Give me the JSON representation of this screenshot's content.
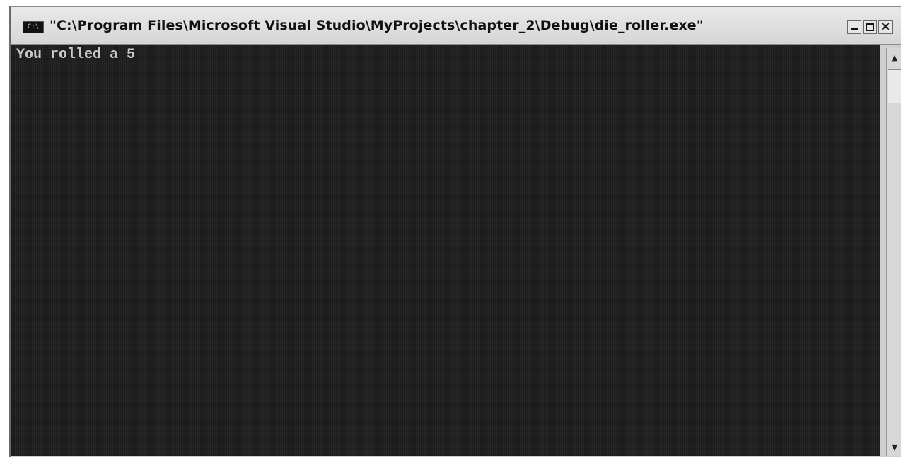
{
  "window": {
    "title": "\"C:\\Program Files\\Microsoft Visual Studio\\MyProjects\\chapter_2\\Debug\\die_roller.exe\"",
    "icon_label": "C:\\",
    "buttons": {
      "minimize_icon": "minimize-icon",
      "maximize_icon": "maximize-icon",
      "close_label": "×"
    }
  },
  "console": {
    "lines": [
      "You rolled a 5"
    ],
    "background_color": "#1c1c1c",
    "text_color": "#c9c9c9"
  },
  "scrollbar": {
    "up_arrow": "▲",
    "down_arrow": "▼"
  }
}
